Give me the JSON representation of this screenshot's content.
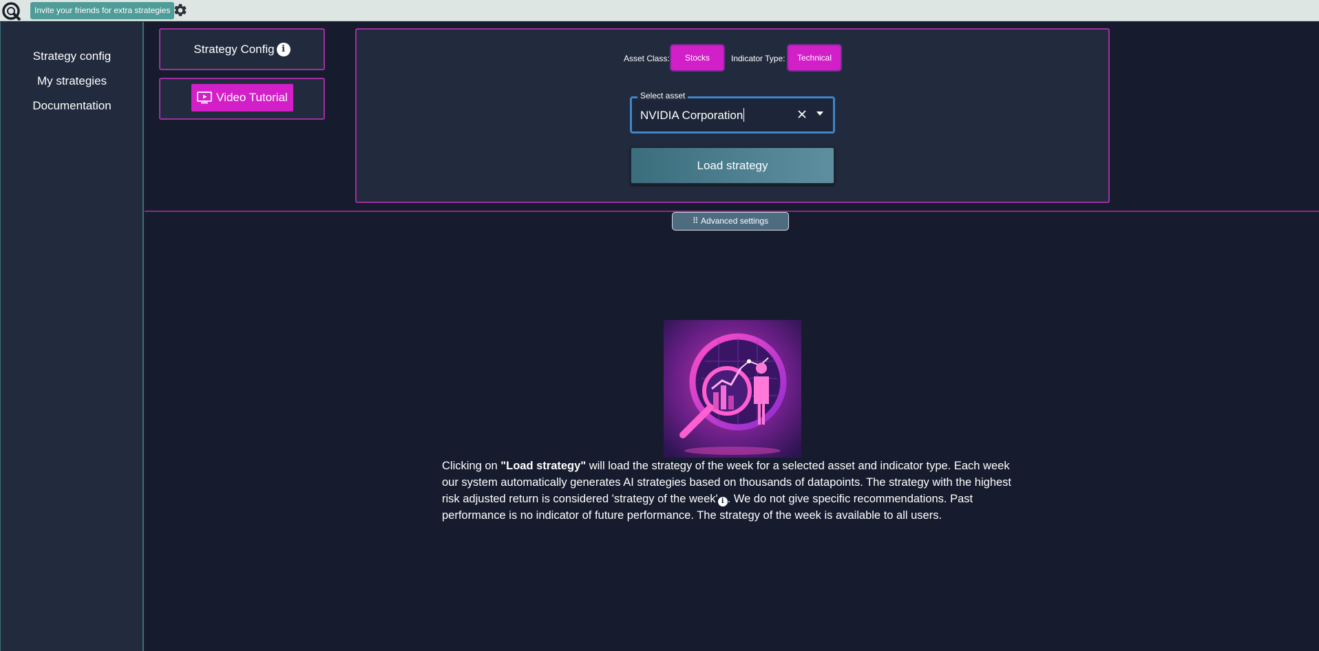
{
  "topbar": {
    "invite_label": "Invite your friends for extra strategies",
    "logo_icon": "q-logo-icon",
    "settings_icon": "gear-icon"
  },
  "sidebar": {
    "items": [
      {
        "label": "Strategy config"
      },
      {
        "label": "My strategies"
      },
      {
        "label": "Documentation"
      }
    ]
  },
  "left_cards": {
    "strategy_config_title": "Strategy Config",
    "video_tutorial_label": "Video Tutorial"
  },
  "config": {
    "asset_class_label": "Asset Class:",
    "asset_class_value": "Stocks",
    "indicator_type_label": "Indicator Type:",
    "indicator_type_value": "Technical",
    "select_asset_label": "Select asset",
    "select_asset_value": "NVIDIA Corporation",
    "load_strategy_label": "Load strategy"
  },
  "advanced": {
    "label": "⠿ Advanced settings"
  },
  "description": {
    "part1": "Clicking on ",
    "bold": "\"Load strategy\"",
    "part2": " will load the strategy of the week for a selected asset and indicator type. Each week our system automatically generates AI strategies based on thousands of datapoints. The strategy with the highest risk adjusted return is considered 'strategy of the week'",
    "part3": ". We do not give specific recommendations. Past performance is no indicator of future performance. The strategy of the week is available to all users."
  },
  "colors": {
    "accent_magenta": "#d21fc8",
    "panel_border": "#a12fa0",
    "background": "#161c2d",
    "invite_teal": "#4f9c98"
  }
}
